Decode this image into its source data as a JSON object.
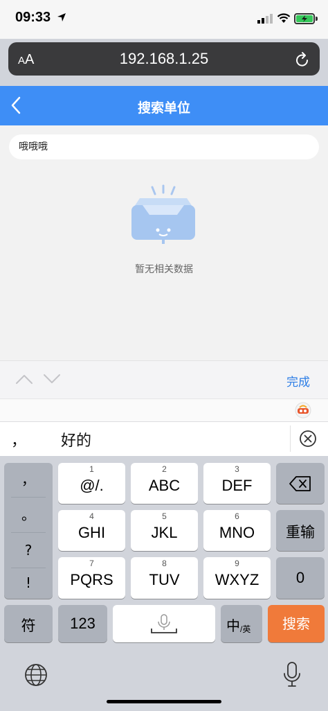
{
  "status_bar": {
    "time": "09:33"
  },
  "browser": {
    "text_size_label_small": "A",
    "text_size_label_big": "A",
    "url": "192.168.1.25"
  },
  "header": {
    "title": "搜索单位",
    "accent_color": "#3e8ef6"
  },
  "search": {
    "value": "哦哦哦"
  },
  "empty_state": {
    "text": "暂无相关数据"
  },
  "accessory": {
    "done_label": "完成"
  },
  "candidates": {
    "items": [
      "，",
      "好的"
    ]
  },
  "keyboard": {
    "symbols": [
      "，",
      "。",
      "?",
      "!"
    ],
    "rows": [
      [
        {
          "num": "1",
          "label": "@/."
        },
        {
          "num": "2",
          "label": "ABC"
        },
        {
          "num": "3",
          "label": "DEF"
        }
      ],
      [
        {
          "num": "4",
          "label": "GHI"
        },
        {
          "num": "5",
          "label": "JKL"
        },
        {
          "num": "6",
          "label": "MNO"
        }
      ],
      [
        {
          "num": "7",
          "label": "PQRS"
        },
        {
          "num": "8",
          "label": "TUV"
        },
        {
          "num": "9",
          "label": "WXYZ"
        }
      ]
    ],
    "retype_label": "重输",
    "zero_label": "0",
    "symbol_label": "符",
    "number_label": "123",
    "lang_main": "中",
    "lang_sub": "/英",
    "search_label": "搜索",
    "search_color": "#f07a3a"
  }
}
